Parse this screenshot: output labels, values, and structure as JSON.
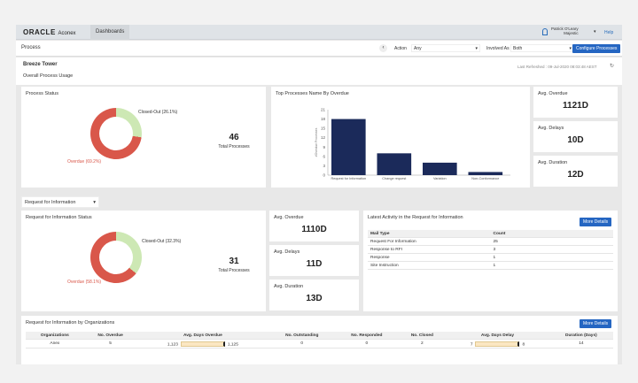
{
  "header": {
    "brand": "ORACLE",
    "product": "Aconex",
    "tab": "Dashboards",
    "user_name": "Patrick O'Leary",
    "user_org": "Majestic",
    "help": "Help"
  },
  "procbar": {
    "title": "Process",
    "action_label": "Action",
    "action_value": "Any",
    "involved_label": "Involved As",
    "involved_value": "Both",
    "configure": "Configure Processes"
  },
  "project": {
    "name": "Breeze Tower",
    "subtitle": "Overall Process Usage",
    "last_refreshed": "Last Refreshed : 09-Jul-2020 08:03:48 AEST"
  },
  "process_status": {
    "title": "Process Status",
    "closed_label": "Closed-Out (26.1%)",
    "overdue_label": "Overdue (69.2%)",
    "closed_pct": 26.1,
    "overdue_pct": 69.2,
    "total": "46",
    "total_label": "Total Processes"
  },
  "chart_data": {
    "type": "bar",
    "title": "Top Processes Name By Overdue",
    "ylabel": "#Overdue Processes",
    "categories": [
      "Request for Information",
      "Change request",
      "Variation",
      "Non-Conformance"
    ],
    "values": [
      18,
      7,
      4,
      1
    ],
    "ylim": [
      0,
      21
    ],
    "yticks": [
      "0",
      "3",
      "6",
      "9",
      "12",
      "15",
      "18",
      "21"
    ],
    "color": "#1b2a5a"
  },
  "overall_stats": [
    {
      "label": "Avg. Overdue",
      "value": "1121D"
    },
    {
      "label": "Avg. Delays",
      "value": "10D"
    },
    {
      "label": "Avg. Duration",
      "value": "12D"
    }
  ],
  "filter": {
    "value": "Request for Information"
  },
  "rfi_status": {
    "title": "Request for Information Status",
    "closed_label": "Closed-Out (32.3%)",
    "overdue_label": "Overdue (58.1%)",
    "closed_pct": 32.3,
    "overdue_pct": 58.1,
    "total": "31",
    "total_label": "Total Processes"
  },
  "rfi_stats": [
    {
      "label": "Avg. Overdue",
      "value": "1110D"
    },
    {
      "label": "Avg. Delays",
      "value": "11D"
    },
    {
      "label": "Avg. Duration",
      "value": "13D"
    }
  ],
  "activity": {
    "title": "Latest Activity in the Request for Information",
    "more": "More Details",
    "headers": [
      "Mail Type",
      "Count"
    ],
    "rows": [
      [
        "Request For Information",
        "25"
      ],
      [
        "Response to RFI",
        "3"
      ],
      [
        "Response",
        "1"
      ],
      [
        "Site Instruction",
        "1"
      ]
    ]
  },
  "orgs": {
    "title": "Request for Information by Organizations",
    "more": "More Details",
    "headers": [
      "Organizations",
      "No. Overdue",
      "Avg. Days Overdue",
      "No. Outstanding",
      "No. Responded",
      "No. Closed",
      "Avg. Days Delay",
      "Duration (Days)"
    ],
    "rows": [
      {
        "org": "Anex",
        "overdue": "5",
        "ado_min": "1,123",
        "ado_max": "1,125",
        "outstanding": "0",
        "responded": "0",
        "closed": "2",
        "add_min": "7",
        "add_max": "8",
        "duration": "14"
      }
    ]
  },
  "colors": {
    "overdue": "#d9574a",
    "closed": "#cde8b4",
    "accent": "#2566c2"
  }
}
